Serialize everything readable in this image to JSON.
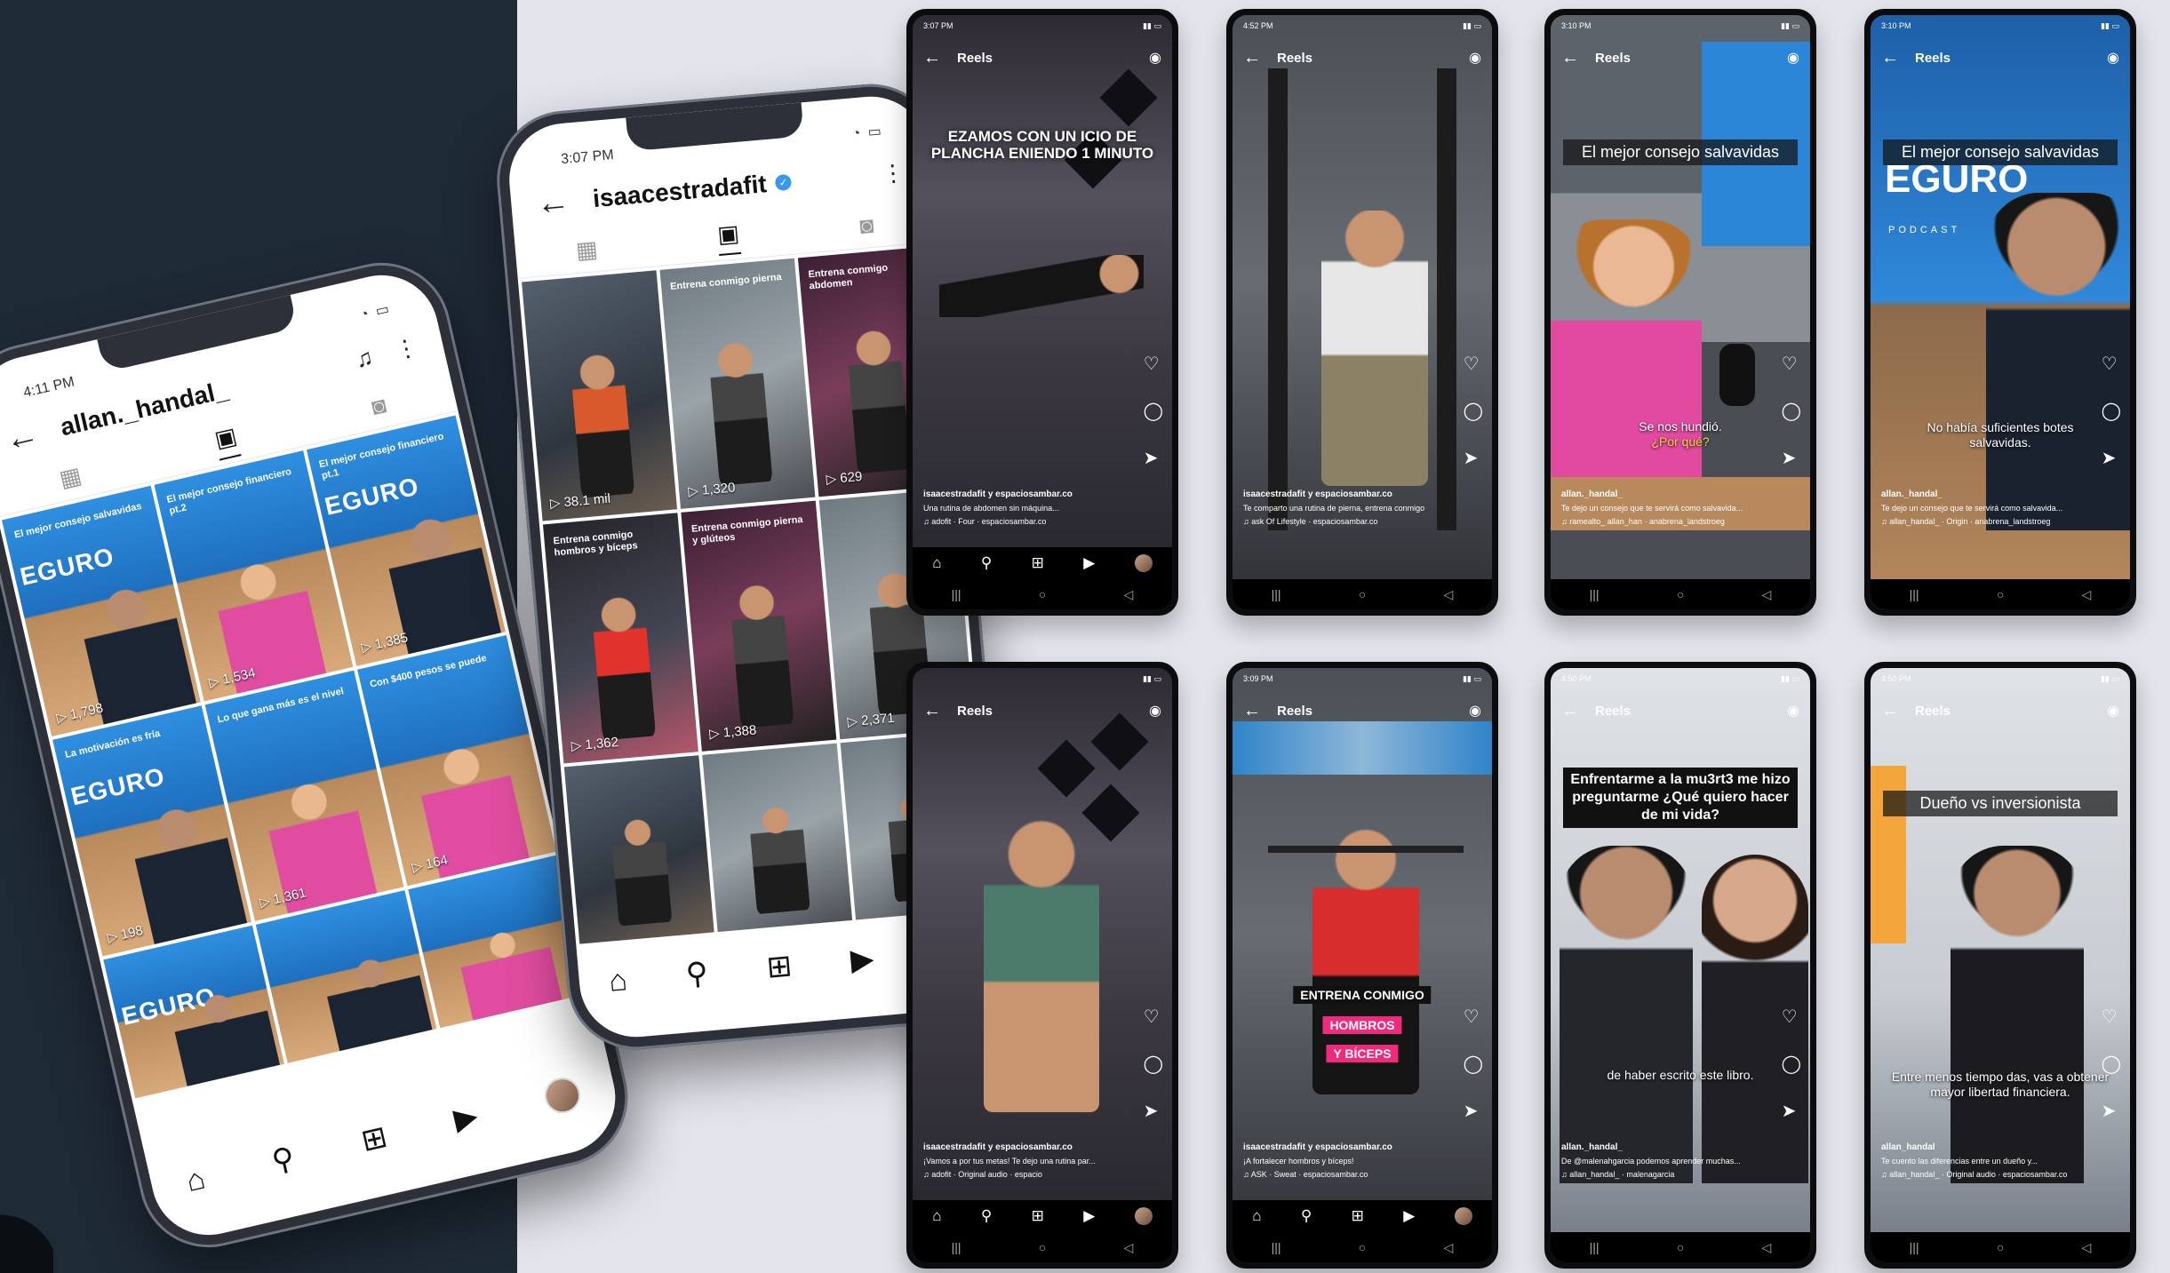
{
  "phone_left": {
    "status_time": "4:11 PM",
    "username": "allan._handal_",
    "view_counts": [
      "1,798",
      "1,534",
      "1,385",
      "198",
      "1,361",
      "164"
    ],
    "tile_captions": [
      "El mejor consejo salvavidas",
      "El mejor consejo financiero pt.2",
      "El mejor consejo financiero pt.1",
      "La motivación es fría",
      "Lo que gana más es el nivel",
      "Con $400 pesos se puede"
    ],
    "logo": "EGURO"
  },
  "phone_center": {
    "status_time": "3:07 PM",
    "username": "isaacestradafit",
    "view_counts": [
      "38.1 mil",
      "1,320",
      "629",
      "1,362",
      "1,388",
      "2,371"
    ],
    "tile_titles": [
      "",
      "Entrena conmigo pierna",
      "Entrena conmigo abdomen",
      "Entrena conmigo hombros y bíceps",
      "Entrena conmigo pierna y glúteos",
      ""
    ]
  },
  "reels": [
    {
      "status_time": "3:07 PM",
      "header": "Reels",
      "overlay": "EZAMOS CON UN ICIO DE PLANCHA ENIENDO 1 MINUTO",
      "account": "isaacestradafit y espaciosambar.co",
      "desc": "Una rutina de abdomen sin máquina...",
      "audio": "adofit · Four",
      "tag": "espaciosambar.co"
    },
    {
      "status_time": "4:52 PM",
      "header": "Reels",
      "overlay": "",
      "account": "isaacestradafit y espaciosambar.co",
      "desc": "Te comparto una rutina de pierna, entrena conmigo",
      "audio": "ask Of Lifestyle",
      "tag": "espaciosambar.co"
    },
    {
      "status_time": "3:10 PM",
      "header": "Reels",
      "overlay": "El mejor consejo salvavidas",
      "subcap_1": "Se nos hundió.",
      "subcap_2": "¿Por qué?",
      "account": "allan._handal_",
      "desc": "Te dejo un consejo que te servirá como salvavida...",
      "audio": "ramealto_ allan_han",
      "tag": "anabrena_landstroeg"
    },
    {
      "status_time": "3:10 PM",
      "header": "Reels",
      "overlay": "El mejor consejo salvavidas",
      "subcap_1": "No había suficientes botes salvavidas.",
      "subcap_2": "",
      "logo": "EGURO",
      "logo_sub": "PODCAST",
      "account": "allan._handal_",
      "desc": "Te dejo un consejo que te servirá como salvavida...",
      "audio": "allan_handal_ · Origin",
      "tag": "anabrena_landstroeg"
    },
    {
      "status_time": "",
      "header": "Reels",
      "overlay": "",
      "account": "isaacestradafit y espaciosambar.co",
      "desc": "¡Vamos a por tus metas! Te dejo una rutina par...",
      "audio": "adofit · Original audio",
      "tag": "espacio"
    },
    {
      "status_time": "3:09 PM",
      "header": "Reels",
      "pill_1": "ENTRENA CONMIGO",
      "pill_2": "HOMBROS",
      "pill_3": "Y BÍCEPS",
      "account": "isaacestradafit y espaciosambar.co",
      "desc": "¡A fortalecer hombros y bíceps!",
      "audio": "ASK · Sweat",
      "tag": "espaciosambar.co"
    },
    {
      "status_time": "4:50 PM",
      "header": "Reels",
      "overlay": "Enfrentarme a la mu3rt3 me hizo preguntarme ¿Qué quiero hacer de mi vida?",
      "subcap_1": "de haber escrito este libro.",
      "account": "allan._handal_",
      "desc": "De @malenahgarcia podemos aprender muchas...",
      "audio": "allan_handal_",
      "tag": "malenagarcia"
    },
    {
      "status_time": "4:50 PM",
      "header": "Reels",
      "overlay": "Dueño vs inversionista",
      "subcap_1": "Entre menos tiempo das, vas a obtener mayor libertad financiera.",
      "account": "allan_handal",
      "desc": "Te cuento las diferencias entre un dueño y...",
      "audio": "allan_handal_ · Original audio",
      "tag": "espaciosambar.co"
    }
  ],
  "icons": {
    "back": "←",
    "reels_tab": "▣",
    "grid_tab": "▦",
    "tagged_tab": "◙",
    "home": "⌂",
    "search": "⚲",
    "add": "⊞",
    "reels": "▶",
    "camera": "◉",
    "heart": "♡",
    "comment": "◯",
    "share": "➤",
    "bell": "🔔"
  }
}
